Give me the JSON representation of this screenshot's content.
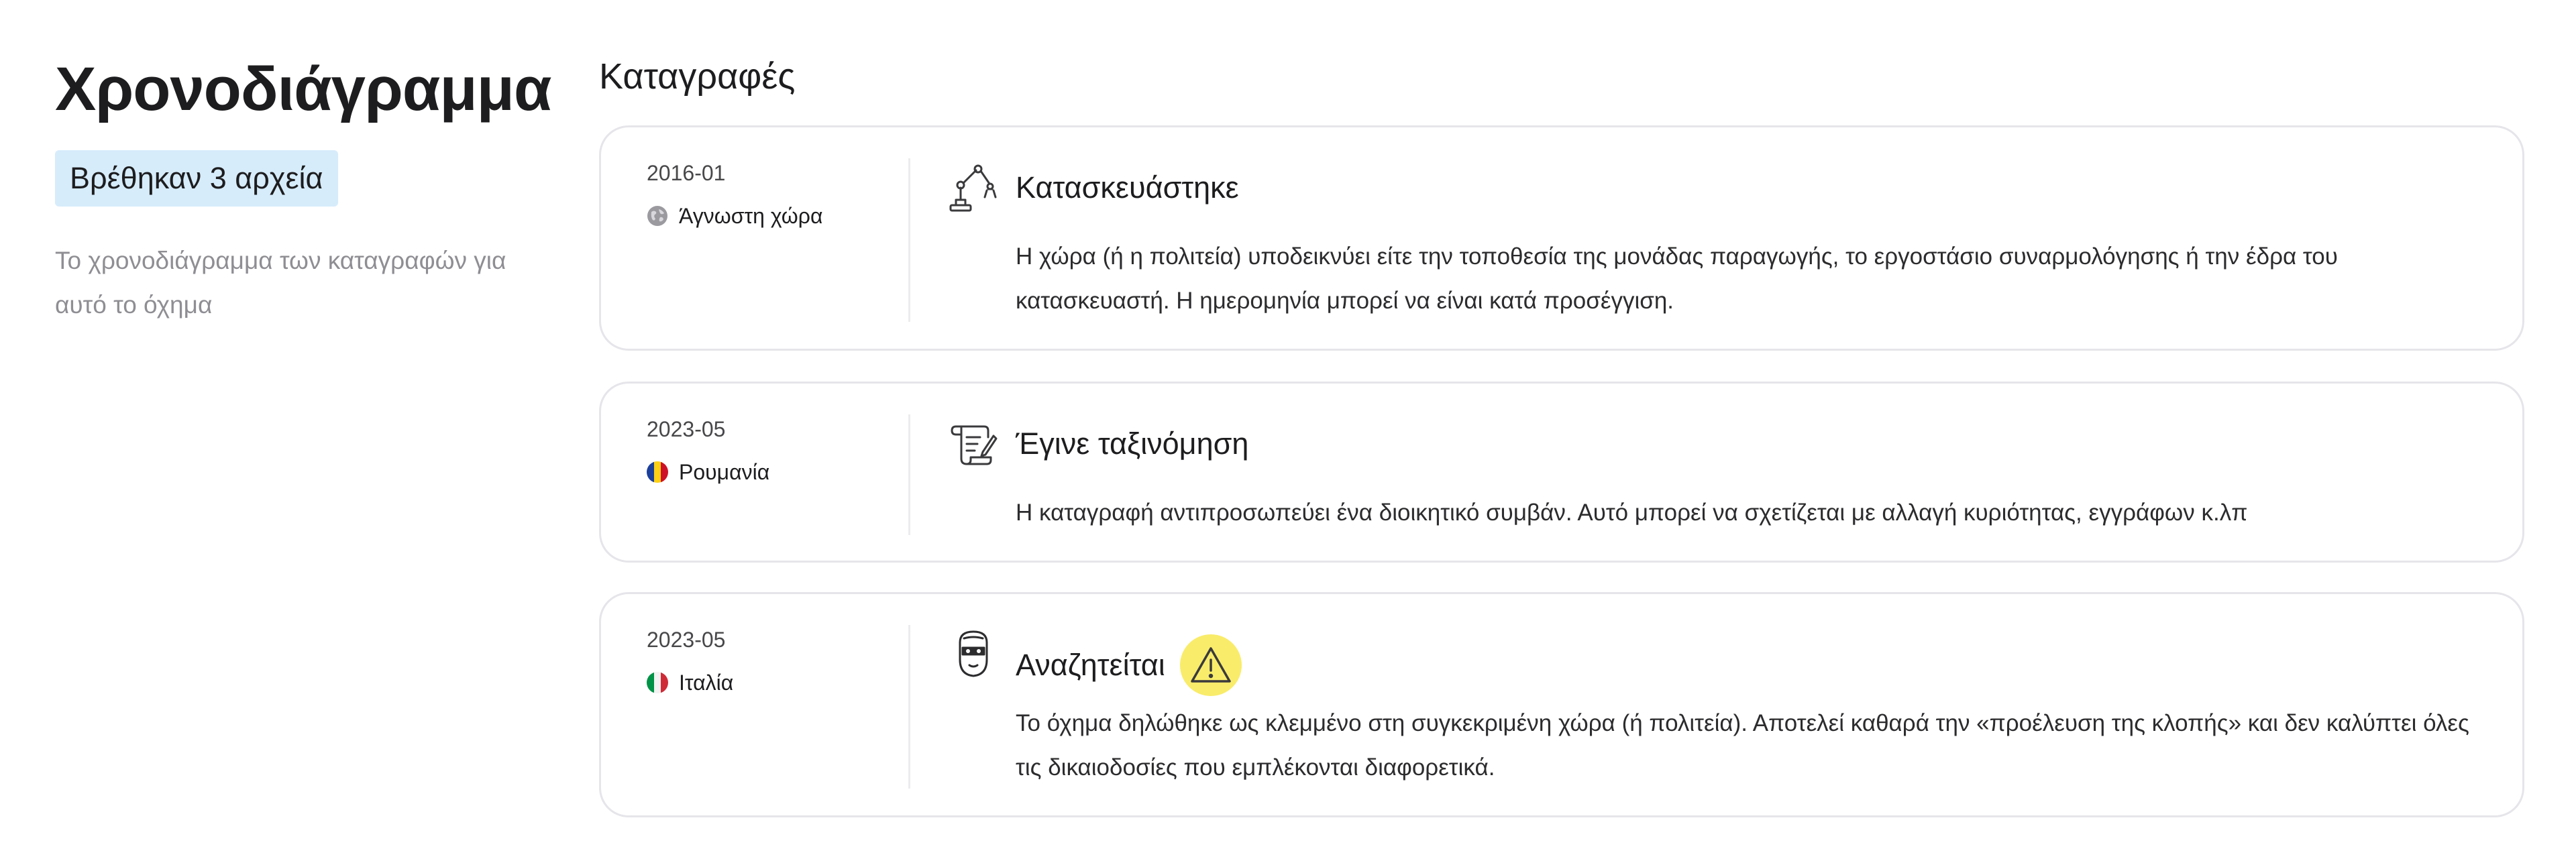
{
  "sidebar": {
    "title": "Χρονοδιάγραμμα",
    "badge": "Βρέθηκαν 3 αρχεία",
    "description": "Το χρονοδιάγραμμα των καταγραφών για αυτό το όχημα"
  },
  "main": {
    "section_title": "Καταγραφές",
    "records": [
      {
        "date": "2016-01",
        "country": "Άγνωστη χώρα",
        "country_icon": "globe-icon",
        "event_icon": "robot-arm-icon",
        "title": "Κατασκευάστηκε",
        "text": "Η χώρα (ή η πολιτεία) υποδεικνύει είτε την τοποθεσία της μονάδας παραγωγής, το εργοστάσιο συναρμολόγησης ή την έδρα του κατασκευαστή. Η ημερομηνία μπορεί να είναι κατά προσέγγιση."
      },
      {
        "date": "2023-05",
        "country": "Ρουμανία",
        "country_icon": "romania-flag-icon",
        "event_icon": "document-scroll-icon",
        "title": "Έγινε ταξινόμηση",
        "text": "Η καταγραφή αντιπροσωπεύει ένα διοικητικό συμβάν. Αυτό μπορεί να σχετίζεται με αλλαγή κυριότητας, εγγράφων κ.λπ"
      },
      {
        "date": "2023-05",
        "country": "Ιταλία",
        "country_icon": "italy-flag-icon",
        "event_icon": "masked-thief-icon",
        "title": "Αναζητείται",
        "warning_icon": "warning-icon",
        "text": "Το όχημα δηλώθηκε ως κλεμμένο στη συγκεκριμένη χώρα (ή πολιτεία). Αποτελεί καθαρά την «προέλευση της κλοπής» και δεν καλύπτει όλες τις δικαιοδοσίες που εμπλέκονται διαφορετικά."
      }
    ]
  },
  "colors": {
    "badge_bg": "#d6ecfb",
    "warning_bg": "#f9ec6a",
    "card_border": "#e5e5ea",
    "muted_text": "#8e8e93"
  }
}
